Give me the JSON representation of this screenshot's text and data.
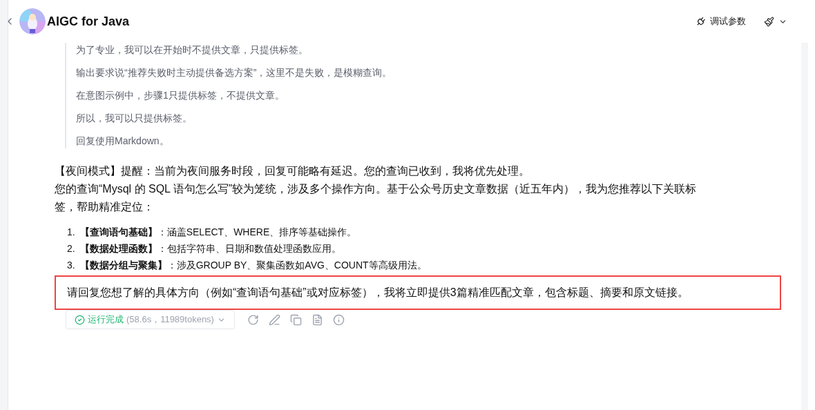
{
  "header": {
    "title": "AIGC for Java",
    "debug_button": "调试参数"
  },
  "thinking": [
    "为了专业，我可以在开始时不提供文章，只提供标签。",
    "输出要求说“推荐失败时主动提供备选方案”，这里不是失败，是模糊查询。",
    "在意图示例中，步骤1只提供标签，不提供文章。",
    "所以，我可以只提供标签。",
    "回复使用Markdown。"
  ],
  "answer": {
    "paragraphs": [
      "【夜间模式】提醒：当前为夜间服务时段，回复可能略有延迟。您的查询已收到，我将优先处理。",
      "您的查询“Mysql 的 SQL 语句怎么写”较为笼统，涉及多个操作方向。基于公众号历史文章数据（近五年内），我为您推荐以下关联标签，帮助精准定位："
    ],
    "list": [
      {
        "number": "1.",
        "text": "**【查询语句基础】**：涵盖SELECT、WHERE、排序等基础操作。"
      },
      {
        "number": "2.",
        "text": "**【数据处理函数】**：包括字符串、日期和数值处理函数应用。"
      },
      {
        "number": "3.",
        "text": "**【数据分组与聚集】**：涉及GROUP BY、聚集函数如AVG、COUNT等高级用法。"
      }
    ],
    "highlighted": "请回复您想了解的具体方向（例如“查询语句基础”或对应标签），我将立即提供3篇精准匹配文章，包含标题、摘要和原文链接。",
    "highlight_on": true
  },
  "status": {
    "label": "运行完成",
    "detail": "(58.6s，11989tokens)",
    "done": true
  }
}
